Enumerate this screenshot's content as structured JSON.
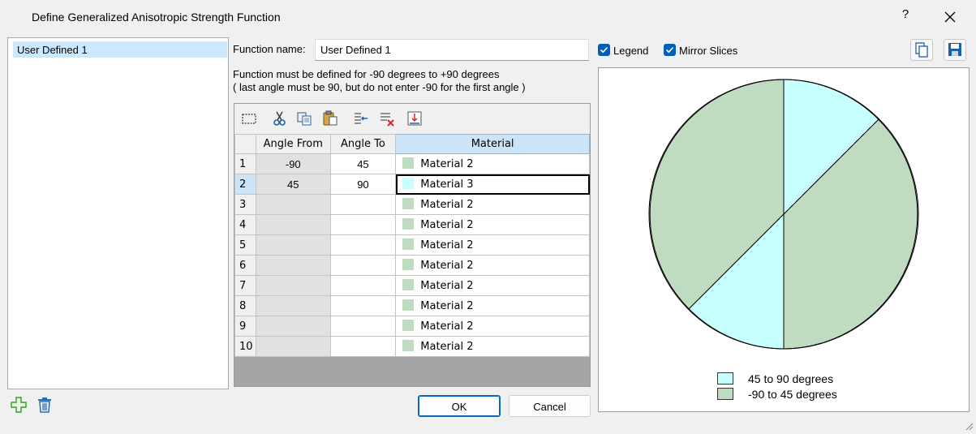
{
  "window": {
    "title": "Define Generalized Anisotropic Strength Function",
    "help_label": "?"
  },
  "function_list": {
    "items": [
      "User Defined 1"
    ]
  },
  "function_name": {
    "label": "Function name:",
    "value": "User Defined 1"
  },
  "note": {
    "line1": "Function must be defined for -90 degrees to +90 degrees",
    "line2": "( last angle must be 90, but do not enter -90 for the first angle )"
  },
  "grid": {
    "headers": {
      "angle_from": "Angle From",
      "angle_to": "Angle To",
      "material": "Material"
    },
    "rows": [
      {
        "n": "1",
        "from": "-90",
        "to": "45",
        "material": "Material 2",
        "color": "#c0dcc0"
      },
      {
        "n": "2",
        "from": "45",
        "to": "90",
        "material": "Material 3",
        "color": "#c8ffff"
      },
      {
        "n": "3",
        "from": "",
        "to": "",
        "material": "Material 2",
        "color": "#c0dcc0"
      },
      {
        "n": "4",
        "from": "",
        "to": "",
        "material": "Material 2",
        "color": "#c0dcc0"
      },
      {
        "n": "5",
        "from": "",
        "to": "",
        "material": "Material 2",
        "color": "#c0dcc0"
      },
      {
        "n": "6",
        "from": "",
        "to": "",
        "material": "Material 2",
        "color": "#c0dcc0"
      },
      {
        "n": "7",
        "from": "",
        "to": "",
        "material": "Material 2",
        "color": "#c0dcc0"
      },
      {
        "n": "8",
        "from": "",
        "to": "",
        "material": "Material 2",
        "color": "#c0dcc0"
      },
      {
        "n": "9",
        "from": "",
        "to": "",
        "material": "Material 2",
        "color": "#c0dcc0"
      },
      {
        "n": "10",
        "from": "",
        "to": "",
        "material": "Material 2",
        "color": "#c0dcc0"
      }
    ]
  },
  "buttons": {
    "ok": "OK",
    "cancel": "Cancel"
  },
  "options": {
    "legend_label": "Legend",
    "legend_checked": true,
    "mirror_label": "Mirror Slices",
    "mirror_checked": true
  },
  "preview": {
    "legend": [
      {
        "label": "45 to 90 degrees",
        "color": "#c8ffff"
      },
      {
        "label": "-90 to 45 degrees",
        "color": "#c0dcc0"
      }
    ]
  },
  "colors": {
    "selection": "#cce8ff",
    "accent": "#005fb8",
    "material_2": "#c0dcc0",
    "material_3": "#c8ffff"
  },
  "icons": [
    "close-icon",
    "add-icon",
    "delete-icon",
    "select-all-icon",
    "cut-icon",
    "copy-icon",
    "paste-icon",
    "insert-row-icon",
    "delete-row-icon",
    "fill-down-icon",
    "copy-image-icon",
    "save-icon"
  ]
}
